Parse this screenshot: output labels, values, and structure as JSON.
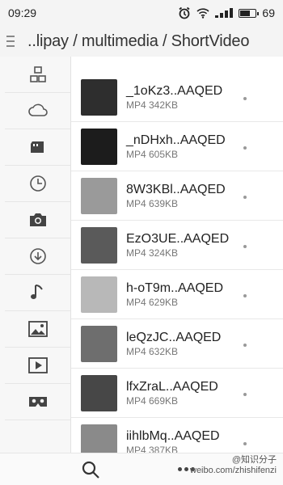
{
  "status_bar": {
    "time": "09:29",
    "battery_level": "69",
    "battery_fraction": 0.69
  },
  "path_bar": {
    "path": "..lipay / multimedia / ShortVideo"
  },
  "sidebar": {
    "items": [
      {
        "icon": "category-icon"
      },
      {
        "icon": "cloud-icon"
      },
      {
        "icon": "sd-card-icon"
      },
      {
        "icon": "clock-icon"
      },
      {
        "icon": "camera-icon"
      },
      {
        "icon": "download-icon"
      },
      {
        "icon": "music-icon"
      },
      {
        "icon": "image-icon"
      },
      {
        "icon": "video-icon"
      },
      {
        "icon": "vr-glasses-icon"
      }
    ]
  },
  "files": [
    {
      "name": "_1oKz3..AAQED",
      "meta": "MP4 342KB",
      "thumb_color": "#2e2e2e"
    },
    {
      "name": "_nDHxh..AAQED",
      "meta": "MP4 605KB",
      "thumb_color": "#1c1c1c"
    },
    {
      "name": "8W3KBl..AAQED",
      "meta": "MP4 639KB",
      "thumb_color": "#9a9a9a"
    },
    {
      "name": "EzO3UE..AAQED",
      "meta": "MP4 324KB",
      "thumb_color": "#5a5a5a"
    },
    {
      "name": "h-oT9m..AAQED",
      "meta": "MP4 629KB",
      "thumb_color": "#b8b8b8"
    },
    {
      "name": "leQzJC..AAQED",
      "meta": "MP4 632KB",
      "thumb_color": "#6e6e6e"
    },
    {
      "name": "lfxZraL..AAQED",
      "meta": "MP4 669KB",
      "thumb_color": "#474747"
    },
    {
      "name": "iihlbMq..AAQED",
      "meta": "MP4 387KB",
      "thumb_color": "#8a8a8a"
    }
  ],
  "bottom_bar": {
    "watermark_line1": "@知识分子",
    "watermark_line2": "weibo.com/zhishifenzi"
  }
}
